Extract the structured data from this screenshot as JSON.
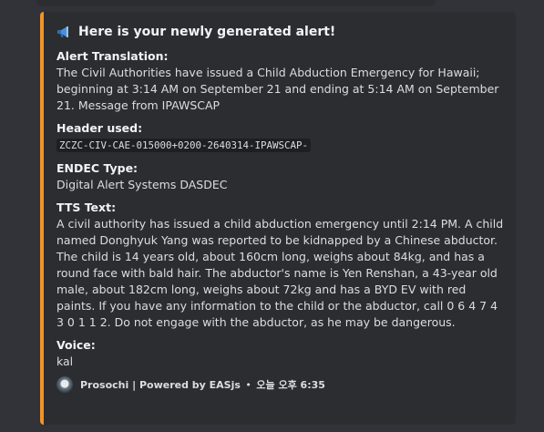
{
  "embed": {
    "accent_color": "#f0932b",
    "title_icon": "megaphone-icon",
    "title": "Here is your newly generated alert!",
    "fields": [
      {
        "name": "Alert Translation:",
        "value": "The Civil Authorities have issued a Child Abduction Emergency for Hawaii; beginning at 3:14 AM on September 21 and ending at 5:14 AM on September 21. Message from IPAWSCAP"
      },
      {
        "name": "Header used:",
        "value": "ZCZC-CIV-CAE-015000+0200-2640314-IPAWSCAP-"
      },
      {
        "name": "ENDEC Type:",
        "value": "Digital Alert Systems DASDEC"
      },
      {
        "name": "TTS Text:",
        "value": "A civil authority has issued a child abduction emergency until 2:14 PM. A child named Donghyuk Yang was reported to be kidnapped by a Chinese abductor. The child is 14 years old, about 160cm long, weighs about 84kg, and has a round face with bald hair. The abductor's name is Yen Renshan, a 43-year old male, about 182cm long, weighs about 72kg and has a BYD EV with red paints. If you have any information to the child or the abductor, call 0 6 4 7 4 3 0 1 1 2. Do not engage with the abductor, as he may be dangerous."
      },
      {
        "name": "Voice:",
        "value": "kal"
      }
    ],
    "footer": {
      "icon": "prosochi-avatar-icon",
      "text": "Prosochi | Powered by EASjs",
      "separator": "•",
      "timestamp": "오늘 오후 6:35"
    }
  }
}
